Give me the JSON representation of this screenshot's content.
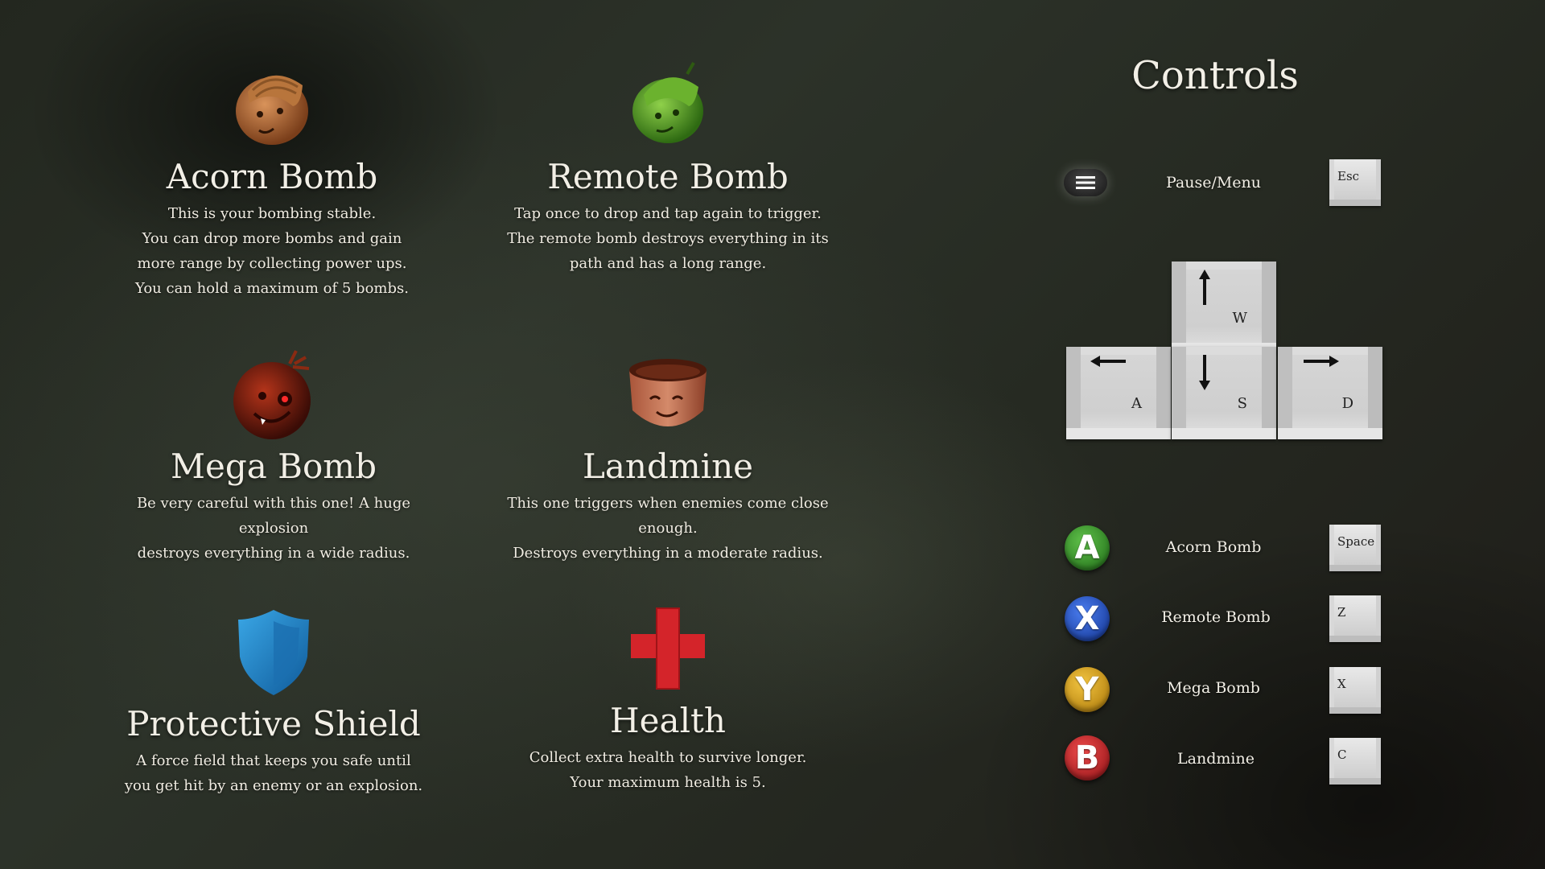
{
  "items": [
    {
      "icon": "acorn-bomb-icon",
      "title": "Acorn Bomb",
      "lines": [
        "This is your bombing stable.",
        "You can drop more bombs and gain",
        "more range by collecting power ups.",
        "You can hold a maximum of 5 bombs."
      ]
    },
    {
      "icon": "remote-bomb-icon",
      "title": "Remote Bomb",
      "lines": [
        "Tap once to drop and tap again to trigger.",
        "The remote bomb destroys everything in its",
        "path and has a long range."
      ]
    },
    {
      "icon": "mega-bomb-icon",
      "title": "Mega Bomb",
      "lines": [
        "Be very careful with this one! A huge explosion",
        "destroys everything in a wide radius."
      ]
    },
    {
      "icon": "landmine-icon",
      "title": "Landmine",
      "lines": [
        "This one triggers when enemies come close enough.",
        "Destroys everything in a moderate radius."
      ]
    },
    {
      "icon": "shield-icon",
      "title": "Protective Shield",
      "lines": [
        "A force field that keeps you safe until",
        "you get hit by an enemy or an explosion."
      ]
    },
    {
      "icon": "health-cross-icon",
      "title": "Health",
      "lines": [
        "Collect extra health to survive longer.",
        "Your maximum health is 5."
      ]
    }
  ],
  "controls": {
    "title": "Controls",
    "pause": {
      "label": "Pause/Menu",
      "key": "Esc",
      "gamepad": "menu-button-icon"
    },
    "movement": {
      "up": "W",
      "left": "A",
      "down": "S",
      "right": "D"
    },
    "actions": [
      {
        "button": "A",
        "color": "#2f8a2a",
        "label": "Acorn Bomb",
        "key": "Space"
      },
      {
        "button": "X",
        "color": "#1f49c0",
        "label": "Remote Bomb",
        "key": "Z"
      },
      {
        "button": "Y",
        "color": "#d9a21a",
        "label": "Mega Bomb",
        "key": "X"
      },
      {
        "button": "B",
        "color": "#c9252b",
        "label": "Landmine",
        "key": "C"
      }
    ]
  }
}
